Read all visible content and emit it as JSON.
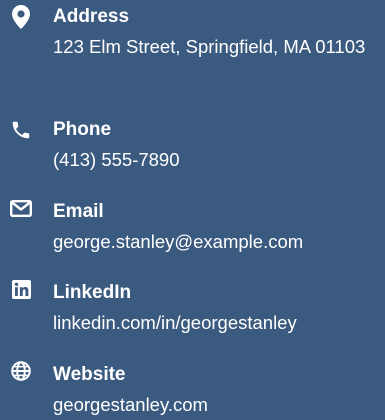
{
  "contact": {
    "items": [
      {
        "id": "address",
        "icon": "map-pin-icon",
        "label": "Address",
        "value": "123 Elm Street, Springfield, MA 01103"
      },
      {
        "id": "phone",
        "icon": "phone-icon",
        "label": "Phone",
        "value": "(413) 555-7890"
      },
      {
        "id": "email",
        "icon": "envelope-icon",
        "label": "Email",
        "value": "george.stanley@example.com"
      },
      {
        "id": "linkedin",
        "icon": "linkedin-icon",
        "label": "LinkedIn",
        "value": "linkedin.com/in/georgestanley"
      },
      {
        "id": "website",
        "icon": "globe-icon",
        "label": "Website",
        "value": "georgestanley.com"
      }
    ]
  },
  "colors": {
    "background": "#3b5a80",
    "text": "#ffffff"
  }
}
